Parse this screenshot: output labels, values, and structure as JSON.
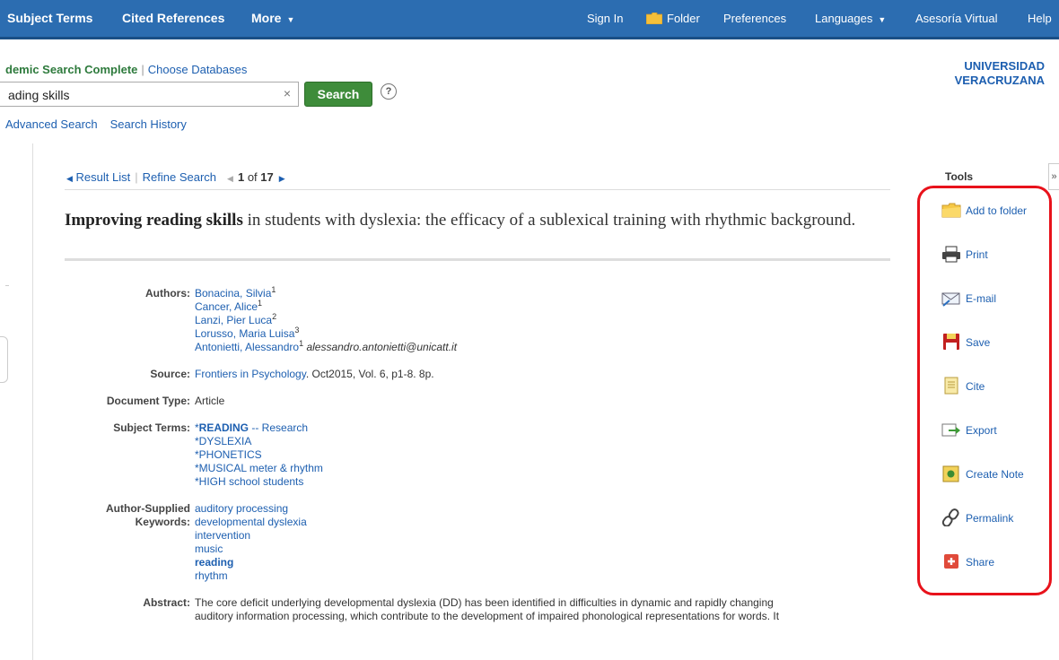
{
  "topnav": {
    "subject_terms": "Subject Terms",
    "cited_references": "Cited References",
    "more": "More",
    "sign_in": "Sign In",
    "folder": "Folder",
    "preferences": "Preferences",
    "languages": "Languages",
    "asesoria": "Asesoría Virtual",
    "help": "Help"
  },
  "search": {
    "database": "demic Search Complete",
    "choose_databases": "Choose Databases",
    "query": "ading skills",
    "clear": "×",
    "button": "Search",
    "help": "?",
    "advanced": "Advanced Search",
    "history": "Search History"
  },
  "institution": {
    "line1": "UNIVERSIDAD",
    "line2": "VERACRUZANA"
  },
  "record_nav": {
    "result_list": "Result List",
    "refine_search": "Refine Search",
    "current": "1",
    "of": "of",
    "total": "17"
  },
  "record": {
    "title_bold": "Improving reading skills",
    "title_rest": " in students with dyslexia: the efficacy of a sublexical training with rhythmic background.",
    "labels": {
      "authors": "Authors:",
      "source": "Source:",
      "doc_type": "Document Type:",
      "subject_terms": "Subject Terms:",
      "keywords_1": "Author-Supplied",
      "keywords_2": "Keywords:",
      "abstract": "Abstract:"
    },
    "authors": [
      {
        "name": "Bonacina, Silvia",
        "sup": "1"
      },
      {
        "name": "Cancer, Alice",
        "sup": "1"
      },
      {
        "name": "Lanzi, Pier Luca",
        "sup": "2"
      },
      {
        "name": "Lorusso, Maria Luisa",
        "sup": "3"
      },
      {
        "name": "Antonietti, Alessandro",
        "sup": "1",
        "email": "alessandro.antonietti@unicatt.it"
      }
    ],
    "source_link": "Frontiers in Psychology",
    "source_rest": ". Oct2015, Vol. 6, p1-8. 8p.",
    "doc_type": "Article",
    "subject_terms": [
      {
        "star": "*",
        "main": "READING",
        "sub": " -- Research"
      },
      {
        "star": "",
        "main": "*DYSLEXIA",
        "sub": ""
      },
      {
        "star": "",
        "main": "*PHONETICS",
        "sub": ""
      },
      {
        "star": "",
        "main": "*MUSICAL meter & rhythm",
        "sub": ""
      },
      {
        "star": "",
        "main": "*HIGH school students",
        "sub": ""
      }
    ],
    "keywords": [
      "auditory processing",
      "developmental dyslexia",
      "intervention",
      "music",
      "reading",
      "rhythm"
    ],
    "abstract_line1": "The core deficit underlying developmental dyslexia (DD) has been identified in difficulties in dynamic and rapidly changing",
    "abstract_line2": "auditory information processing, which contribute to the development of impaired phonological representations for words. It"
  },
  "tools": {
    "heading": "Tools",
    "collapse": "»",
    "items": [
      {
        "label": "Add to folder",
        "icon": "folder-icon"
      },
      {
        "label": "Print",
        "icon": "printer-icon"
      },
      {
        "label": "E-mail",
        "icon": "email-icon"
      },
      {
        "label": "Save",
        "icon": "floppy-disk-icon"
      },
      {
        "label": "Cite",
        "icon": "document-icon"
      },
      {
        "label": "Export",
        "icon": "export-icon"
      },
      {
        "label": "Create Note",
        "icon": "note-icon"
      },
      {
        "label": "Permalink",
        "icon": "link-icon"
      },
      {
        "label": "Share",
        "icon": "plus-share-icon"
      }
    ]
  },
  "colors": {
    "topbar": "#2c6db1",
    "link": "#1d5fb0",
    "search_button": "#3e8c3a",
    "highlight_box": "#e8121b"
  }
}
